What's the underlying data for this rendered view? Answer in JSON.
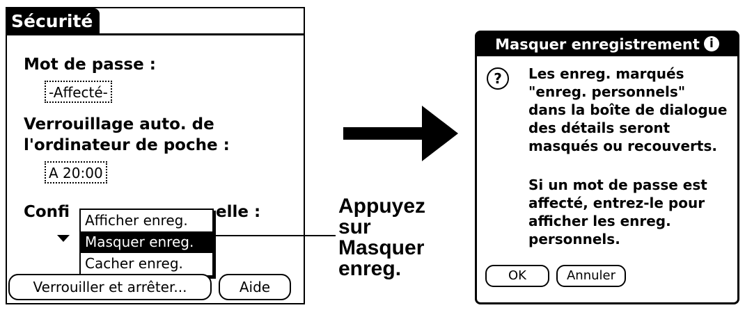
{
  "security_screen": {
    "title": "Sécurité",
    "password_label": "Mot de passe :",
    "password_value": "-Affecté-",
    "autolock_label_line1": "Verrouillage auto. de",
    "autolock_label_line2": "l'ordinateur de poche :",
    "autolock_value": "A 20:00",
    "privacy_label_start": "Confi",
    "privacy_label_end": "elle :",
    "privacy_menu": {
      "items": [
        "Afficher enreg.",
        "Masquer enreg.",
        "Cacher enreg."
      ],
      "selected_index": 1
    },
    "lock_button": "Verrouiller et arrêter...",
    "help_button": "Aide"
  },
  "callout": {
    "line1": "Appuyez",
    "line2": "sur",
    "line3": "Masquer",
    "line4": "enreg."
  },
  "dialog": {
    "title": "Masquer enregistrement",
    "info_icon_glyph": "i",
    "question_icon_glyph": "?",
    "message_paragraph1": "Les enreg. marqués\n\"enreg. personnels\"\ndans la boîte de dialogue\ndes détails seront\nmasqués ou recouverts.",
    "message_paragraph2": "Si un mot de passe est\naffecté, entrez-le pour\nafficher les enreg.\npersonnels.",
    "ok_button": "OK",
    "cancel_button": "Annuler"
  }
}
